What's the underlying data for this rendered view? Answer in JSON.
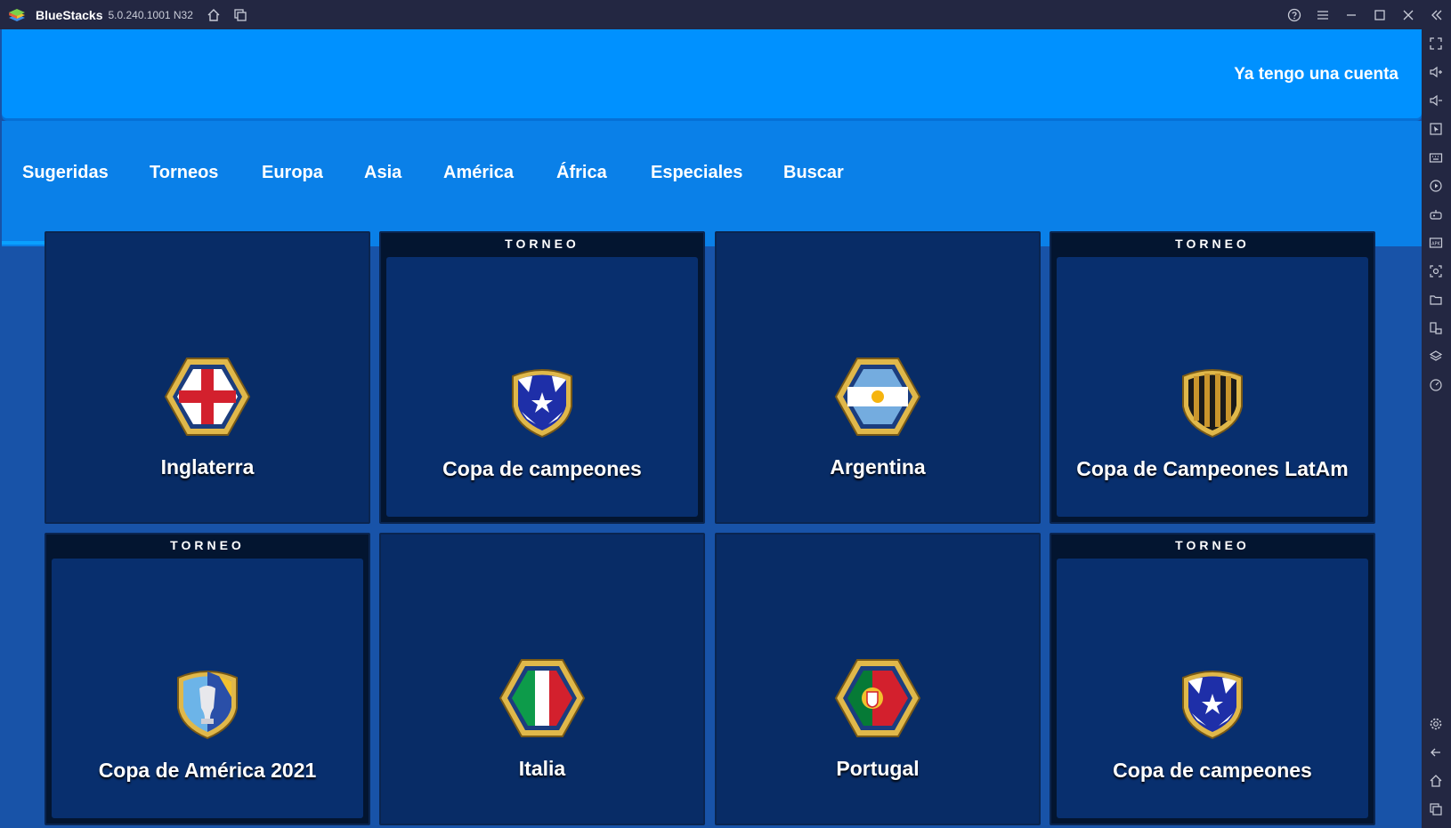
{
  "window": {
    "app_name": "BlueStacks",
    "version": "5.0.240.1001 N32"
  },
  "header": {
    "login_link": "Ya tengo una cuenta"
  },
  "tabs": [
    {
      "label": "Sugeridas",
      "active": true
    },
    {
      "label": "Torneos"
    },
    {
      "label": "Europa"
    },
    {
      "label": "Asia"
    },
    {
      "label": "América"
    },
    {
      "label": "África"
    },
    {
      "label": "Especiales"
    },
    {
      "label": "Buscar"
    }
  ],
  "cards": [
    {
      "title": "Inglaterra",
      "emblem": "england-flag-icon"
    },
    {
      "badge": "TORNEO",
      "title": "Copa de campeones",
      "emblem": "champions-cup-icon"
    },
    {
      "title": "Argentina",
      "emblem": "argentina-flag-icon"
    },
    {
      "badge": "TORNEO",
      "title": "Copa de Campeones LatAm",
      "emblem": "latam-cup-icon"
    },
    {
      "badge": "TORNEO",
      "title": "Copa de América 2021",
      "emblem": "copa-america-icon"
    },
    {
      "title": "Italia",
      "emblem": "italy-flag-icon"
    },
    {
      "title": "Portugal",
      "emblem": "portugal-flag-icon"
    },
    {
      "badge": "TORNEO",
      "title": "Copa de campeones",
      "emblem": "champions-cup-icon"
    }
  ],
  "colors": {
    "header_blue": "#0091ff",
    "tabs_blue": "#0a80e8",
    "background_blue": "#1853a8",
    "card_navy": "#082c66",
    "gold": "#e0b84a"
  }
}
